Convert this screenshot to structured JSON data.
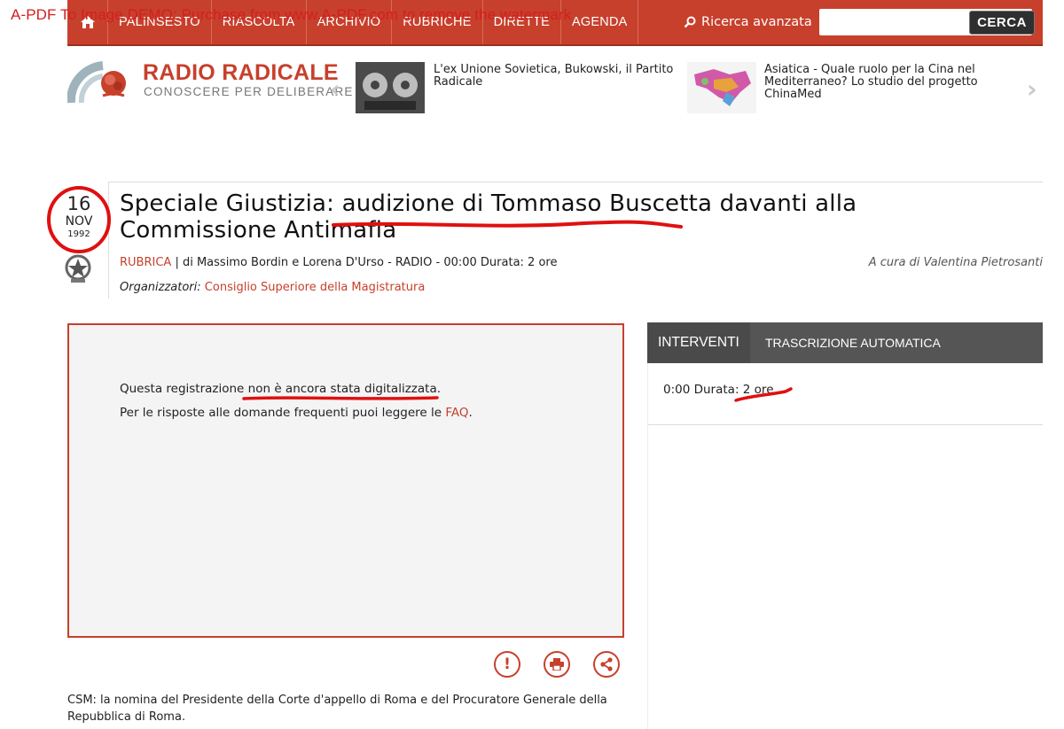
{
  "watermark": "A-PDF To Image DEMO: Purchase from www.A-PDF.com to remove the watermark",
  "nav": {
    "items": [
      "PALINSESTO",
      "RIASCOLTA",
      "ARCHIVIO",
      "RUBRICHE",
      "DIRETTE",
      "AGENDA"
    ],
    "advanced_search": "Ricerca avanzata",
    "search_placeholder": "",
    "search_button": "CERCA"
  },
  "logo": {
    "title": "RADIO RADICALE",
    "subtitle": "CONOSCERE PER DELIBERARE"
  },
  "featured": [
    {
      "text": "L'ex Unione Sovietica, Bukowski, il Partito Radicale"
    },
    {
      "text": "Asiatica - Quale ruolo per la Cina nel Mediterraneo? Lo studio del progetto ChinaMed"
    }
  ],
  "article": {
    "day": "16",
    "month": "NOV",
    "year": "1992",
    "title": "Speciale Giustizia: audizione di Tommaso Buscetta davanti alla Commissione Antimafia",
    "rubrica": "RUBRICA",
    "meta": "| di Massimo Bordin e Lorena D'Urso - RADIO - 00:00 Durata: 2 ore",
    "curator": "A cura di Valentina Pietrosanti",
    "org_label": "Organizzatori:",
    "org_value": "Consiglio Superiore della Magistratura"
  },
  "player": {
    "line1": "Questa registrazione non è ancora stata digitalizzata.",
    "line2_prefix": "Per le risposte alle domande frequenti puoi leggere le",
    "faq_link": "FAQ",
    "line2_suffix": "."
  },
  "caption": "CSM: la nomina del Presidente della Corte d'appello di Roma e del Procuratore Generale della Repubblica di Roma.",
  "side_panel": {
    "tab_interventi": "INTERVENTI",
    "tab_trascrizione": "TRASCRIZIONE AUTOMATICA",
    "entry_time": "0:00 Durata:",
    "entry_duration": "2 ore"
  },
  "colors": {
    "accent": "#c7402c",
    "annotation": "#e01010",
    "panel_header": "#555555"
  },
  "icons": [
    "home-icon",
    "search-icon",
    "chevron-left-icon",
    "chevron-right-icon",
    "report-icon",
    "print-icon",
    "share-icon",
    "emblem-icon"
  ]
}
